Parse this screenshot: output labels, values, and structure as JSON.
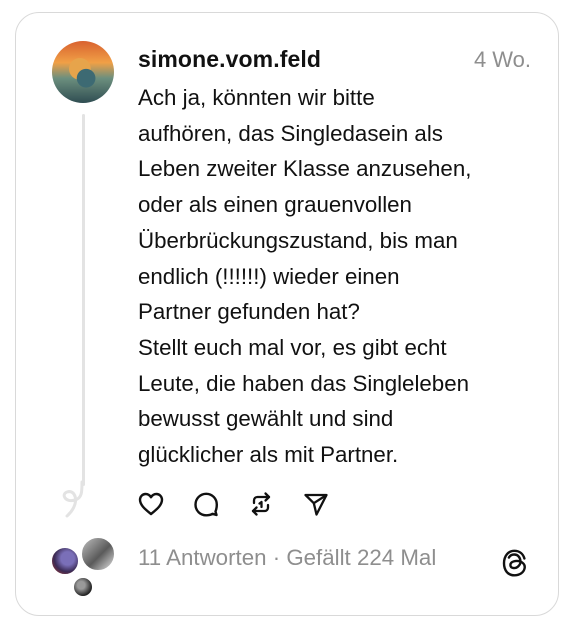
{
  "post": {
    "username": "simone.vom.feld",
    "time": "4 Wo.",
    "lines": [
      "Ach ja, könnten wir bitte",
      "aufhören, das Singledasein als",
      "Leben zweiter Klasse anzusehen,",
      "oder als einen grauenvollen",
      "Überbrückungszustand, bis man",
      "endlich (!!!!!!) wieder einen",
      "Partner gefunden hat?",
      "Stellt euch mal vor, es gibt echt",
      "Leute, die haben das Singleleben",
      "bewusst gewählt und sind",
      "glücklicher als mit Partner."
    ]
  },
  "actions": [
    "heart-icon",
    "comment-icon",
    "repost-icon",
    "share-icon"
  ],
  "footer": {
    "stats": "11 Antworten · Gefällt 224 Mal"
  },
  "icons": {
    "logo": "threads-logo-icon"
  }
}
